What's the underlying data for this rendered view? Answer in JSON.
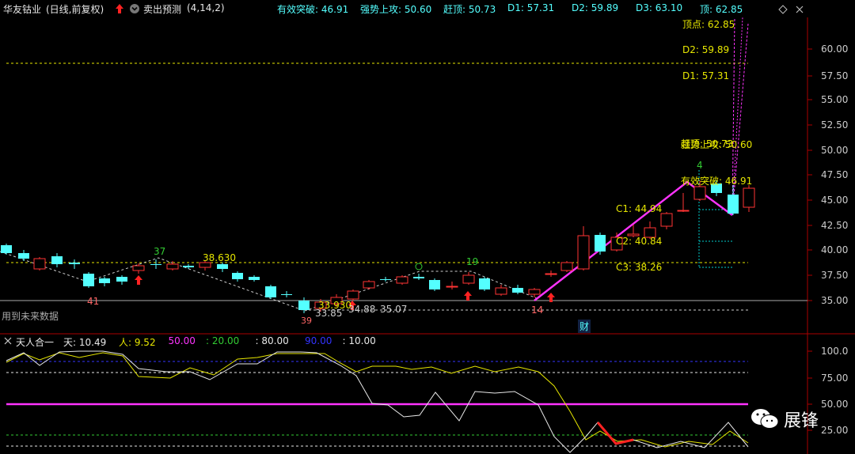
{
  "header": {
    "stock_name": "华友钴业",
    "mode": "(日线,前复权)",
    "indicator": "卖出预测",
    "params": "(4,14,2)",
    "readouts": [
      {
        "label": "有效突破:",
        "value": "46.91"
      },
      {
        "label": "强势上攻:",
        "value": "50.60"
      },
      {
        "label": "赶顶:",
        "value": "50.73"
      },
      {
        "label": "D1:",
        "value": "57.31"
      },
      {
        "label": "D2:",
        "value": "59.89"
      },
      {
        "label": "D3:",
        "value": "63.10"
      },
      {
        "label": "顶:",
        "value": "62.85"
      }
    ]
  },
  "main_axis": {
    "ticks": [
      "60.00",
      "57.50",
      "55.00",
      "52.50",
      "50.00",
      "47.50",
      "45.00",
      "42.50",
      "40.00",
      "37.50",
      "35.00"
    ]
  },
  "main_labels": {
    "future_data": "用到未来数据",
    "caiwu": "财",
    "high_37": "37",
    "low_41": "41",
    "low_39": "39",
    "mark_19": "19",
    "low_14": "14",
    "mark_4": "4",
    "level_38630": "38.630",
    "level_33930": "33.930",
    "level_3385": "33.85",
    "level_3488": "34.88",
    "level_3507": "35.07",
    "ding_label": "顶点: 62.85",
    "d2_label": "D2: 59.89",
    "d1_label": "D1: 57.31",
    "gan_ding": "赶顶: 50.73",
    "qiang_shi": "强势上攻: 50.60",
    "you_xiao": "有效突破: 46.91",
    "c1": "C1: 44.94",
    "c2": "C2: 40.84",
    "c3": "C3: 38.26"
  },
  "sub_header": {
    "name": "天人合一",
    "items": [
      {
        "text": "天: 10.49",
        "color": "#e8e8e8"
      },
      {
        "text": "人: 9.52",
        "color": "#e6e600"
      },
      {
        "text": "50.00",
        "color": "#ff33ff"
      },
      {
        "text": ": 20.00",
        "color": "#33cc33"
      },
      {
        "text": ": 80.00",
        "color": "#e8e8e8"
      },
      {
        "text": "90.00",
        "color": "#3333ff"
      },
      {
        "text": ": 10.00",
        "color": "#e8e8e8"
      }
    ]
  },
  "sub_axis": {
    "ticks": [
      "100.0",
      "75.00",
      "50.00",
      "25.00"
    ]
  },
  "watermark": {
    "text": "展锋"
  },
  "colors": {
    "up": "#ff3333",
    "down": "#54ffff",
    "magenta": "#ff33ff",
    "yellow": "#e6e600",
    "cyan": "#00cccc"
  }
}
